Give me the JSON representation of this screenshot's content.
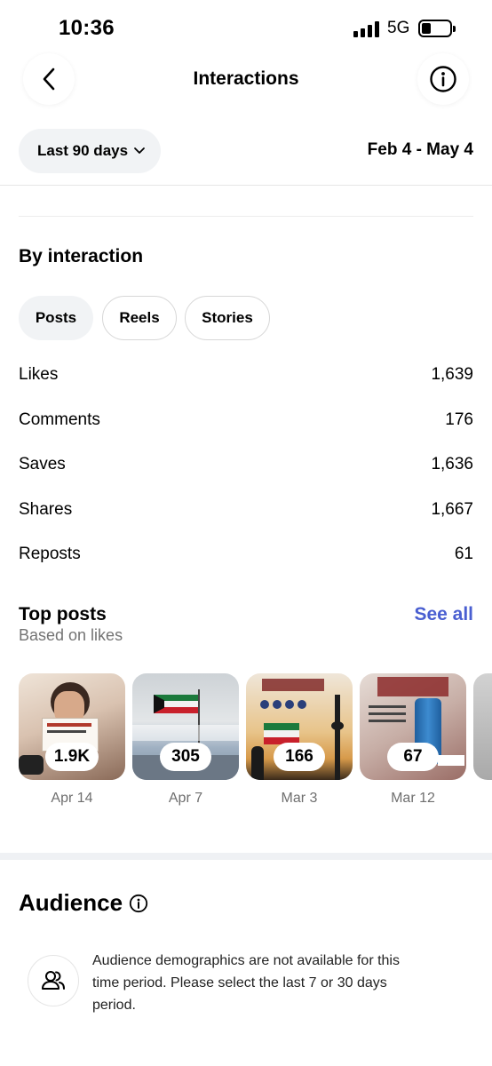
{
  "status_bar": {
    "time": "10:36",
    "network": "5G"
  },
  "header": {
    "title": "Interactions",
    "back_icon": "chevron-left-icon",
    "info_icon": "info-circle-icon"
  },
  "filter": {
    "period_label": "Last 90 days",
    "date_range": "Feb 4 - May 4"
  },
  "by_interaction": {
    "title": "By interaction",
    "tabs": [
      {
        "label": "Posts",
        "active": true
      },
      {
        "label": "Reels",
        "active": false
      },
      {
        "label": "Stories",
        "active": false
      }
    ],
    "metrics": [
      {
        "label": "Likes",
        "value": "1,639"
      },
      {
        "label": "Comments",
        "value": "176"
      },
      {
        "label": "Saves",
        "value": "1,636"
      },
      {
        "label": "Shares",
        "value": "1,667"
      },
      {
        "label": "Reposts",
        "value": "61"
      }
    ]
  },
  "top_posts": {
    "title": "Top posts",
    "subtitle": "Based on likes",
    "see_all": "See all",
    "accent_color": "#4a5fd1",
    "posts": [
      {
        "count": "1.9K",
        "date": "Apr 14"
      },
      {
        "count": "305",
        "date": "Apr 7"
      },
      {
        "count": "166",
        "date": "Mar 3"
      },
      {
        "count": "67",
        "date": "Mar 12"
      }
    ]
  },
  "audience": {
    "title": "Audience",
    "message": "Audience demographics are not available for this time period. Please select the last 7 or 30 days period."
  }
}
